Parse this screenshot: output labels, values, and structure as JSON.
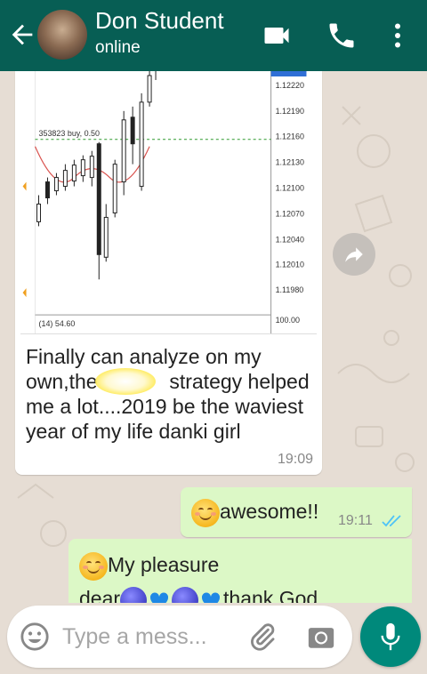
{
  "header": {
    "contact_name": "Don Student",
    "status": "online"
  },
  "chart_image": {
    "order_label": "353823 buy, 0.50",
    "price_ticks": [
      "1.12220",
      "1.12190",
      "1.12160",
      "1.12130",
      "1.12100",
      "1.12070",
      "1.12040",
      "1.12010",
      "1.11980"
    ],
    "indicator_label": "(14) 54.60",
    "indicator_scale": "100.00"
  },
  "messages": {
    "incoming": {
      "caption_part1": "Finally can analyze on my own,the",
      "caption_part2": "strategy helped me a lot....2019 be the waviest year of my life danki girl",
      "time": "19:09"
    },
    "outgoing1": {
      "text": "awesome!!",
      "time": "19:11"
    },
    "outgoing2": {
      "line1": "My pleasure",
      "line2_start": "dear",
      "line2_end": "thank God"
    }
  },
  "input": {
    "placeholder": "Type a mess..."
  },
  "colors": {
    "header": "#075e54",
    "outgoing_bubble": "#dcf8c6",
    "mic_button": "#00897b",
    "read_ticks": "#4fc3f7"
  },
  "icons": [
    "back-arrow-icon",
    "video-call-icon",
    "phone-icon",
    "more-options-icon",
    "forward-icon",
    "emoji-icon",
    "attach-icon",
    "camera-icon",
    "mic-icon"
  ]
}
